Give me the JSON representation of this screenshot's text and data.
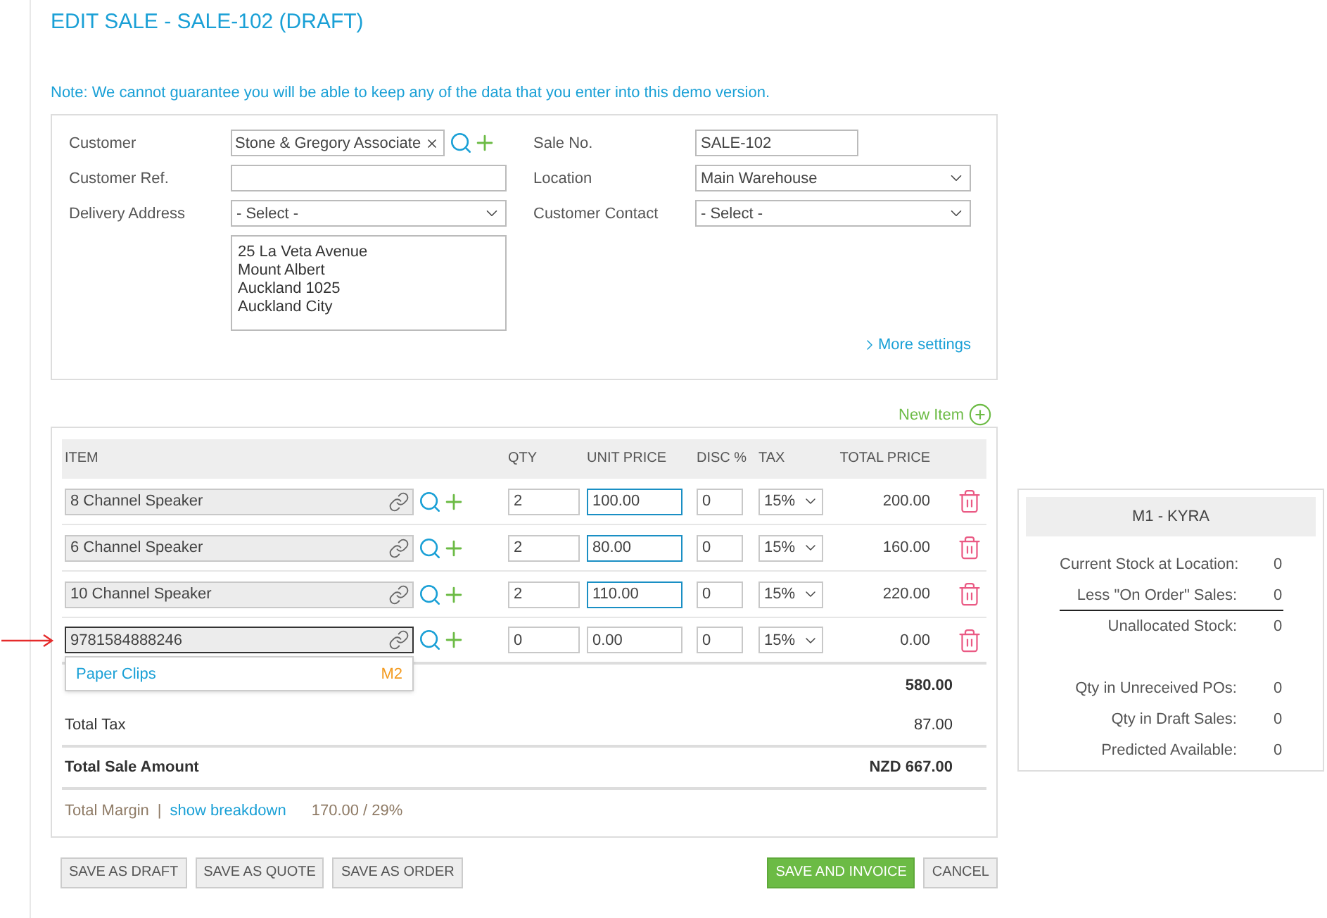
{
  "page": {
    "title": "EDIT SALE - SALE-102 (DRAFT)",
    "note": "Note: We cannot guarantee you will be able to keep any of the data that you enter into this demo version."
  },
  "sale_form": {
    "left_fields": [
      {
        "kind": "customer",
        "label": "Customer",
        "value": "Stone & Gregory Associate"
      },
      {
        "kind": "text",
        "label": "Customer Ref."
      },
      {
        "kind": "select",
        "label": "Delivery Address",
        "value": "- Select -"
      },
      {
        "kind": "address",
        "lines": [
          "25 La Veta Avenue",
          "Mount Albert",
          "Auckland 1025",
          "Auckland City"
        ]
      }
    ],
    "right_fields": [
      {
        "kind": "short_text",
        "label": "Sale No.",
        "value": "SALE-102"
      },
      {
        "kind": "select",
        "label": "Location",
        "value": "Main Warehouse"
      },
      {
        "kind": "select",
        "label": "Customer Contact",
        "value": "- Select -"
      }
    ],
    "more_settings": "More settings"
  },
  "line_items": {
    "new_item": "New Item",
    "columns": [
      "ITEM",
      "QTY",
      "UNIT PRICE",
      "DISC %",
      "TAX",
      "TOTAL PRICE"
    ],
    "rows": [
      {
        "item": "8 Channel Speaker",
        "focused": false,
        "qty": "2",
        "unit_price": "100.00",
        "price_highlighted": true,
        "disc": "0",
        "tax": "15%",
        "total": "200.00"
      },
      {
        "item": "6 Channel Speaker",
        "focused": false,
        "qty": "2",
        "unit_price": "80.00",
        "price_highlighted": true,
        "disc": "0",
        "tax": "15%",
        "total": "160.00"
      },
      {
        "item": "10 Channel Speaker",
        "focused": false,
        "qty": "2",
        "unit_price": "110.00",
        "price_highlighted": true,
        "disc": "0",
        "tax": "15%",
        "total": "220.00"
      },
      {
        "item": "9781584888246",
        "focused": true,
        "qty": "0",
        "unit_price": "0.00",
        "price_highlighted": false,
        "disc": "0",
        "tax": "15%",
        "total": "0.00"
      }
    ],
    "suggestions": [
      {
        "label": "Paper Clips",
        "code": "M2"
      }
    ]
  },
  "totals": [
    {
      "kind": "subtotal",
      "value": "580.00"
    },
    {
      "kind": "tax",
      "label": "Total Tax",
      "value": "87.00"
    },
    {
      "kind": "grand",
      "label": "Total Sale Amount",
      "value": "NZD 667.00"
    }
  ],
  "margin": {
    "label": "Total Margin",
    "separator": "|",
    "link": "show breakdown",
    "value": "170.00 / 29%"
  },
  "actions": {
    "left": [
      {
        "label": "SAVE AS DRAFT",
        "primary": false
      },
      {
        "label": "SAVE AS QUOTE",
        "primary": false
      },
      {
        "label": "SAVE AS ORDER",
        "primary": false
      }
    ],
    "right": [
      {
        "label": "SAVE AND INVOICE",
        "primary": true
      },
      {
        "label": "CANCEL",
        "primary": false
      }
    ]
  },
  "stock_panel": {
    "title": "M1 - KYRA",
    "groups": [
      {
        "rows": [
          {
            "label": "Current Stock at Location:",
            "value": "0",
            "rule_below": false
          },
          {
            "label": "Less \"On Order\" Sales:",
            "value": "0",
            "rule_below": true
          },
          {
            "label": "Unallocated Stock:",
            "value": "0",
            "rule_below": false
          }
        ]
      },
      {
        "rows": [
          {
            "label": "Qty in Unreceived POs:",
            "value": "0",
            "rule_below": false
          },
          {
            "label": "Qty in Draft Sales:",
            "value": "0",
            "rule_below": false
          },
          {
            "label": "Predicted Available:",
            "value": "0",
            "rule_below": false
          }
        ]
      }
    ]
  }
}
